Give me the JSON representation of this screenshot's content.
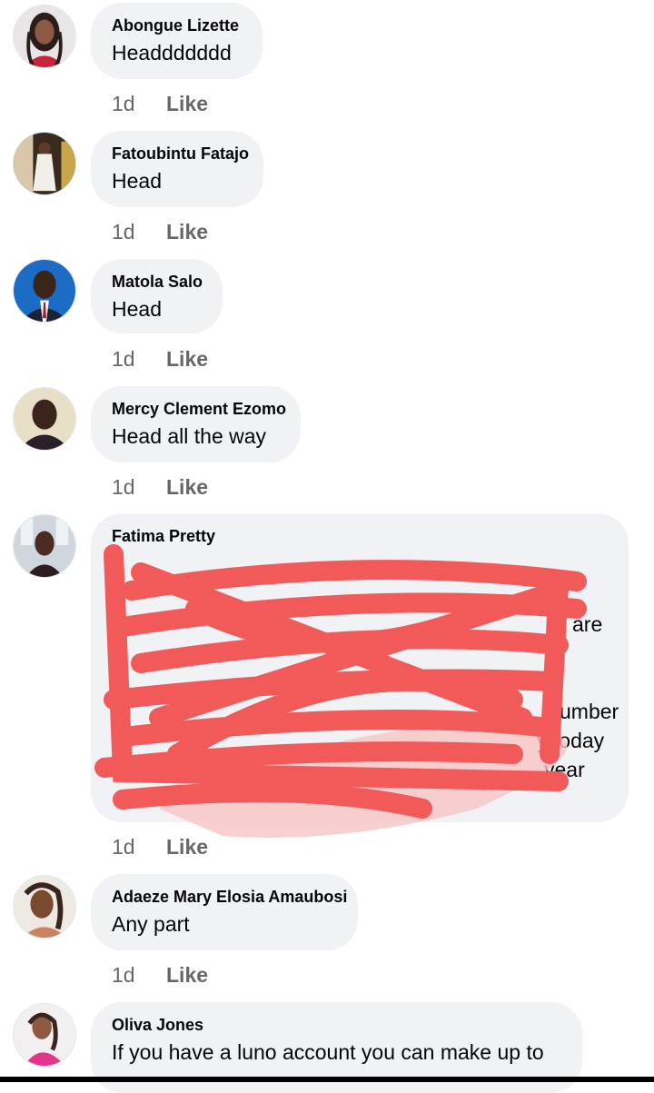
{
  "comments": [
    {
      "author": "Abongue Lizette",
      "text": "Headdddddd",
      "time": "1d",
      "like": "Like",
      "avatar": "profile-photo-woman-braids"
    },
    {
      "author": "Fatoubintu Fatajo",
      "text": "Head",
      "time": "1d",
      "like": "Like",
      "avatar": "profile-photo-woman-white-dress"
    },
    {
      "author": "Matola Salo",
      "text": "Head",
      "time": "1d",
      "like": "Like",
      "avatar": "profile-photo-man-suit-blue"
    },
    {
      "author": "Mercy Clement Ezomo",
      "text": "Head all the way",
      "time": "1d",
      "like": "Like",
      "avatar": "profile-photo-woman-light"
    },
    {
      "author": "Fatima Pretty",
      "text_lines": [
        "are",
        "umber",
        "y today",
        "year"
      ],
      "time": "1d",
      "like": "Like",
      "avatar": "profile-photo-woman-indoor",
      "redacted": true
    },
    {
      "author": "Adaeze Mary Elosia Amaubosi",
      "text": "Any part",
      "time": "1d",
      "like": "Like",
      "avatar": "profile-photo-woman-selfie"
    },
    {
      "author": "Oliva Jones",
      "text": "If you have a luno account you can make up to",
      "time": "",
      "like": "",
      "avatar": "profile-photo-woman-pink"
    }
  ],
  "colors": {
    "bubble": "#f0f2f5",
    "meta_text": "#65676b",
    "scribble": "#f25a5a"
  }
}
